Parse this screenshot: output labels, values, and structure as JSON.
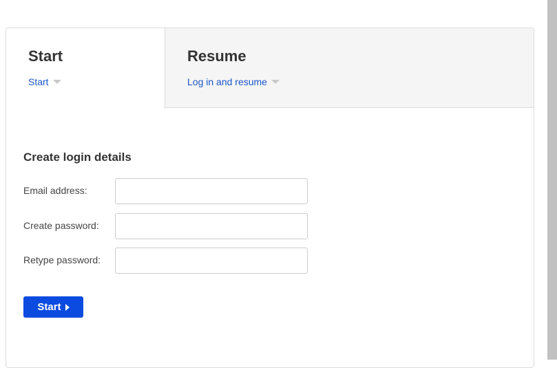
{
  "tabs": {
    "start": {
      "title": "Start",
      "link": "Start",
      "icon": "caret-down-icon"
    },
    "resume": {
      "title": "Resume",
      "link": "Log in and resume",
      "icon": "caret-down-icon"
    }
  },
  "form": {
    "heading": "Create login details",
    "fields": [
      {
        "label": "Email address:",
        "value": "",
        "placeholder": ""
      },
      {
        "label": "Create password:",
        "value": "",
        "placeholder": ""
      },
      {
        "label": "Retype password:",
        "value": "",
        "placeholder": ""
      }
    ],
    "submit_label": "Start",
    "submit_icon": "play-icon"
  },
  "colors": {
    "accent": "#0b4be0",
    "link": "#1a55c9",
    "inactive_tab_bg": "#f5f5f5"
  }
}
